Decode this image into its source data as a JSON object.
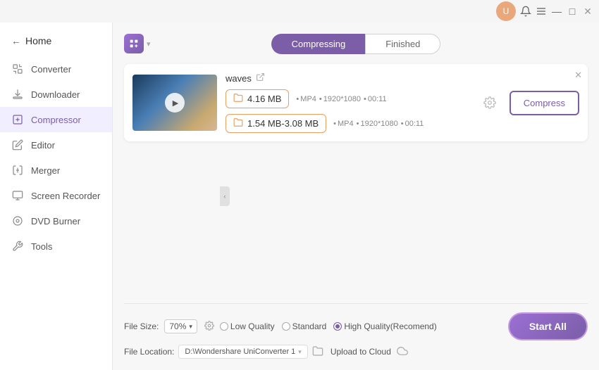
{
  "titlebar": {
    "user_icon": "U",
    "bell_icon": "🔔",
    "menu_icon": "☰",
    "minimize_icon": "—",
    "maximize_icon": "□",
    "close_icon": "✕"
  },
  "sidebar": {
    "home_label": "Home",
    "items": [
      {
        "id": "converter",
        "label": "Converter",
        "icon": "converter"
      },
      {
        "id": "downloader",
        "label": "Downloader",
        "icon": "downloader"
      },
      {
        "id": "compressor",
        "label": "Compressor",
        "icon": "compressor",
        "active": true
      },
      {
        "id": "editor",
        "label": "Editor",
        "icon": "editor"
      },
      {
        "id": "merger",
        "label": "Merger",
        "icon": "merger"
      },
      {
        "id": "screen-recorder",
        "label": "Screen Recorder",
        "icon": "screen-recorder"
      },
      {
        "id": "dvd-burner",
        "label": "DVD Burner",
        "icon": "dvd-burner"
      },
      {
        "id": "tools",
        "label": "Tools",
        "icon": "tools"
      }
    ]
  },
  "tabs": [
    {
      "id": "compressing",
      "label": "Compressing",
      "active": true
    },
    {
      "id": "finished",
      "label": "Finished",
      "active": false
    }
  ],
  "file_card": {
    "file_name": "waves",
    "original_size": "4.16 MB",
    "original_format": "MP4",
    "original_resolution": "1920*1080",
    "original_duration": "00:11",
    "compressed_size": "1.54 MB-3.08 MB",
    "compressed_format": "MP4",
    "compressed_resolution": "1920*1080",
    "compressed_duration": "00:11",
    "compress_button": "Compress"
  },
  "bottom_bar": {
    "file_size_label": "File Size:",
    "file_size_value": "70%",
    "quality_options": [
      {
        "id": "low",
        "label": "Low Quality",
        "checked": false
      },
      {
        "id": "standard",
        "label": "Standard",
        "checked": false
      },
      {
        "id": "high",
        "label": "High Quality(Recomend)",
        "checked": true
      }
    ],
    "file_location_label": "File Location:",
    "location_path": "D:\\Wondershare UniConverter 1",
    "upload_to_cloud": "Upload to Cloud",
    "start_all_button": "Start All"
  }
}
